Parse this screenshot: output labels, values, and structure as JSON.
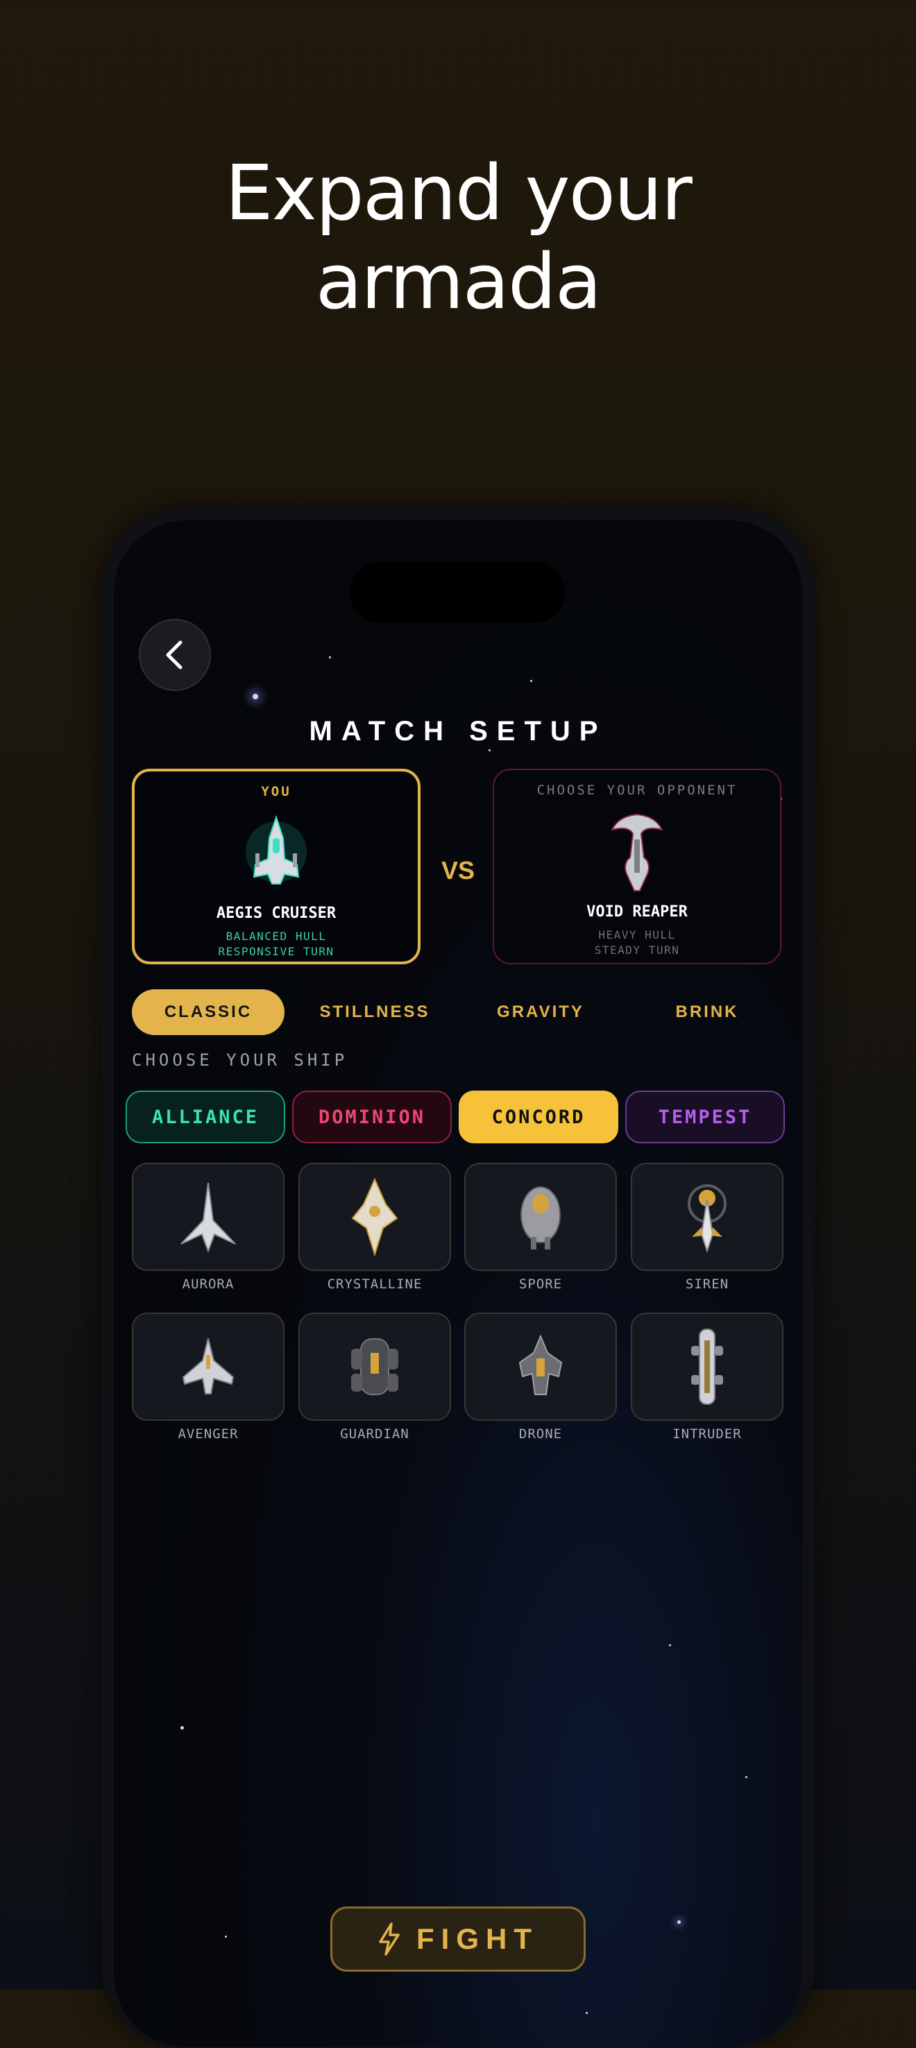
{
  "headline": {
    "line1": "Expand your",
    "line2": "armada"
  },
  "screen": {
    "title": "MATCH SETUP",
    "back_icon": "chevron-left-icon",
    "player_card": {
      "label": "YOU",
      "ship_name": "AEGIS CRUISER",
      "trait1": "BALANCED HULL",
      "trait2": "RESPONSIVE TURN"
    },
    "vs": "VS",
    "opponent_card": {
      "label": "CHOOSE YOUR OPPONENT",
      "ship_name": "VOID REAPER",
      "trait1": "HEAVY HULL",
      "trait2": "STEADY TURN"
    },
    "modes": [
      {
        "label": "CLASSIC",
        "selected": true
      },
      {
        "label": "STILLNESS",
        "selected": false
      },
      {
        "label": "GRAVITY",
        "selected": false
      },
      {
        "label": "BRINK",
        "selected": false
      }
    ],
    "choose_label": "CHOOSE YOUR SHIP",
    "factions": [
      {
        "label": "ALLIANCE",
        "color": "#3ee0b5"
      },
      {
        "label": "DOMINION",
        "color": "#ee4673"
      },
      {
        "label": "CONCORD",
        "color": "#f6c23a",
        "selected": true
      },
      {
        "label": "TEMPEST",
        "color": "#b55ef0"
      }
    ],
    "ships": [
      {
        "name": "AURORA"
      },
      {
        "name": "CRYSTALLINE"
      },
      {
        "name": "SPORE"
      },
      {
        "name": "SIREN"
      },
      {
        "name": "AVENGER"
      },
      {
        "name": "GUARDIAN"
      },
      {
        "name": "DRONE"
      },
      {
        "name": "INTRUDER"
      }
    ],
    "fight_label": "FIGHT",
    "fight_icon": "lightning-bolt-icon",
    "accent_color": "#e4b44c"
  }
}
